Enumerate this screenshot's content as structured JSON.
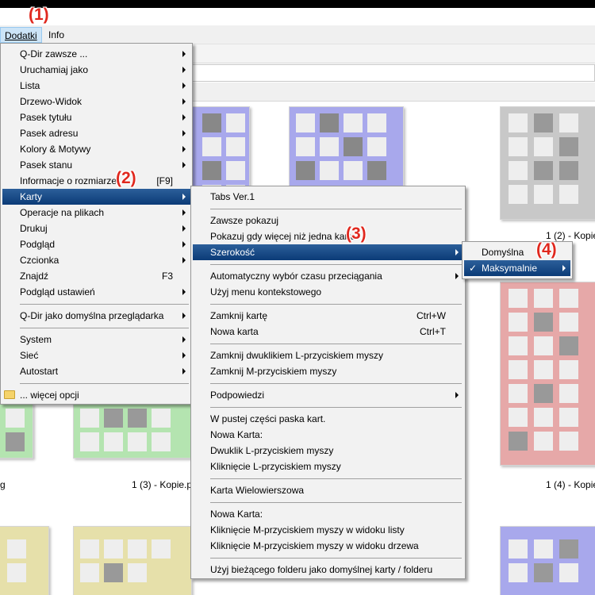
{
  "menubar": {
    "items": [
      "Dodatki",
      "Info"
    ]
  },
  "badges": [
    "(1)",
    "(2)",
    "(3)",
    "(4)"
  ],
  "menu1": {
    "items": [
      {
        "label": "Q-Dir zawsze ...",
        "shortcut": ""
      },
      {
        "label": "Uruchamiaj jako",
        "shortcut": ""
      },
      {
        "label": "Lista",
        "shortcut": ""
      },
      {
        "label": "Drzewo-Widok",
        "shortcut": ""
      },
      {
        "label": "Pasek tytułu",
        "shortcut": ""
      },
      {
        "label": "Pasek adresu",
        "shortcut": ""
      },
      {
        "label": "Kolory & Motywy",
        "shortcut": ""
      },
      {
        "label": "Pasek stanu",
        "shortcut": ""
      },
      {
        "label": "Informacje o rozmiarze",
        "shortcut": "[F9]"
      },
      {
        "label": "Karty",
        "shortcut": ""
      },
      {
        "label": "Operacje na plikach",
        "shortcut": ""
      },
      {
        "label": "Drukuj",
        "shortcut": ""
      },
      {
        "label": "Podgląd",
        "shortcut": ""
      },
      {
        "label": "Czcionka",
        "shortcut": ""
      },
      {
        "label": "Znajdź",
        "shortcut": "F3"
      },
      {
        "label": "Podgląd ustawień",
        "shortcut": ""
      },
      {
        "label": "Q-Dir jako domyślna przeglądarka",
        "shortcut": ""
      },
      {
        "label": "System",
        "shortcut": ""
      },
      {
        "label": "Sieć",
        "shortcut": ""
      },
      {
        "label": "Autostart",
        "shortcut": ""
      },
      {
        "label": "... więcej opcji",
        "shortcut": ""
      }
    ]
  },
  "menu2": {
    "items": [
      {
        "label": "Tabs Ver.1",
        "shortcut": ""
      },
      {
        "label": "Zawsze pokazuj",
        "shortcut": ""
      },
      {
        "label": "Pokazuj gdy więcej niż jedna karta",
        "shortcut": ""
      },
      {
        "label": "Szerokość",
        "shortcut": ""
      },
      {
        "label": "Automatyczny wybór czasu przeciągania",
        "shortcut": ""
      },
      {
        "label": "Użyj menu kontekstowego",
        "shortcut": ""
      },
      {
        "label": "Zamknij kartę",
        "shortcut": "Ctrl+W"
      },
      {
        "label": "Nowa karta",
        "shortcut": "Ctrl+T"
      },
      {
        "label": "Zamknij dwuklikiem L-przyciskiem myszy",
        "shortcut": ""
      },
      {
        "label": "Zamknij M-przyciskiem myszy",
        "shortcut": ""
      },
      {
        "label": "Podpowiedzi",
        "shortcut": ""
      },
      {
        "label": "W pustej części paska kart.",
        "shortcut": ""
      },
      {
        "label": "Nowa Karta:",
        "shortcut": ""
      },
      {
        "label": "Dwuklik L-przyciskiem myszy",
        "shortcut": ""
      },
      {
        "label": "Kliknięcie L-przyciskiem myszy",
        "shortcut": ""
      },
      {
        "label": "Karta Wielowierszowa",
        "shortcut": ""
      },
      {
        "label": "Nowa Karta:",
        "shortcut": ""
      },
      {
        "label": "Kliknięcie M-przyciskiem myszy w widoku listy",
        "shortcut": ""
      },
      {
        "label": "Kliknięcie M-przyciskiem myszy w widoku drzewa",
        "shortcut": ""
      },
      {
        "label": "Użyj bieżącego folderu jako domyślnej karty / folderu",
        "shortcut": ""
      }
    ]
  },
  "menu3": {
    "items": [
      {
        "label": "Domyślna",
        "shortcut": ""
      },
      {
        "label": "Maksymalnie",
        "shortcut": ""
      }
    ]
  },
  "files": [
    "1 (2) - Kopie",
    "g",
    "1 (3) - Kopie.p",
    "1 (4) - Kopie"
  ],
  "colors": {
    "blue": "#a8a8ec",
    "gray": "#c8c8c8",
    "red": "#e6a8a8",
    "green": "#b4e4b0",
    "yellow": "#e6e0aa",
    "highlight": "#0b3b77",
    "badge": "#e0281e"
  }
}
